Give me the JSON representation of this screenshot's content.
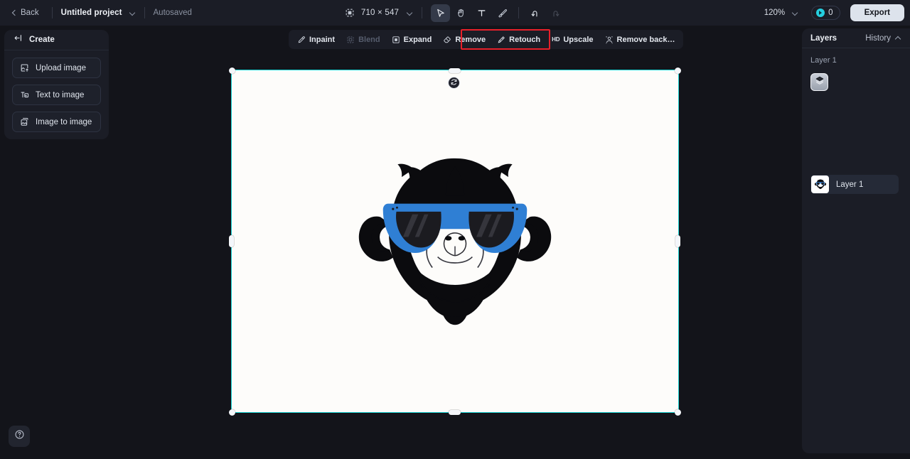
{
  "topbar": {
    "back_label": "Back",
    "project_name": "Untitled project",
    "project_menu_icon": "chevron-down-icon",
    "autosaved_label": "Autosaved",
    "canvas_size_label": "710 × 547",
    "canvas_size_icon": "image-size-icon",
    "canvas_size_menu_icon": "chevron-down-icon",
    "tools": [
      {
        "name": "select-tool",
        "icon": "cursor-arrow-icon",
        "active": true,
        "disabled": false
      },
      {
        "name": "pan-tool",
        "icon": "hand-icon",
        "active": false,
        "disabled": false
      },
      {
        "name": "text-tool",
        "icon": "text-t-icon",
        "active": false,
        "disabled": false
      },
      {
        "name": "brush-tool",
        "icon": "paintbrush-icon",
        "active": false,
        "disabled": false
      },
      {
        "name": "undo-button",
        "icon": "undo-arrow-icon",
        "active": false,
        "disabled": false
      },
      {
        "name": "redo-button",
        "icon": "redo-arrow-icon",
        "active": false,
        "disabled": true
      }
    ],
    "zoom_label": "120%",
    "zoom_menu_icon": "chevron-down-icon",
    "credits_icon": "credit-coin-icon",
    "credits_count": "0",
    "export_label": "Export"
  },
  "actionbar": {
    "items": [
      {
        "label": "Inpaint",
        "icon": "inpaint-wand-icon",
        "disabled": false,
        "highlighted": false
      },
      {
        "label": "Blend",
        "icon": "blend-icon",
        "disabled": true,
        "highlighted": false
      },
      {
        "label": "Expand",
        "icon": "expand-icon",
        "disabled": false,
        "highlighted": false
      },
      {
        "label": "Remove",
        "icon": "eraser-icon",
        "disabled": false,
        "highlighted": false
      },
      {
        "label": "Retouch",
        "icon": "retouch-wand-icon",
        "disabled": false,
        "highlighted": true
      },
      {
        "label": "Upscale",
        "icon": "hd-badge-icon",
        "disabled": false,
        "highlighted": true
      },
      {
        "label": "Remove back…",
        "icon": "remove-background-icon",
        "disabled": false,
        "highlighted": false
      }
    ],
    "annotation_color": "#e8202a"
  },
  "left_panel": {
    "title": "Create",
    "collapse_icon": "collapse-panel-icon",
    "items": [
      {
        "label": "Upload image",
        "icon": "upload-image-icon"
      },
      {
        "label": "Text to image",
        "icon": "text-to-image-icon"
      },
      {
        "label": "Image to image",
        "icon": "image-to-image-icon"
      }
    ]
  },
  "right_panel": {
    "title": "Layers",
    "history_label": "History",
    "history_icon": "chevron-up-icon",
    "group_label": "Layer 1",
    "thumbnail_icon": "layers-stack-icon",
    "layers": [
      {
        "label": "Layer 1",
        "thumbnail_icon": "monkey-sunglasses-thumbnail"
      }
    ]
  },
  "canvas": {
    "artboard_background": "#fdfcfa",
    "selection_color": "#1ad5d5",
    "handle_color": "#f4f6fa",
    "rotate_handle_icon": "rotate-icon",
    "artwork_name": "monkey-with-blue-sunglasses",
    "artwork_colors": {
      "outline": "#0b0b0e",
      "glasses_frame": "#2f7fd4",
      "lens": "#1b1b20"
    }
  },
  "help": {
    "icon": "question-mark-circle-icon",
    "label": "Help"
  }
}
